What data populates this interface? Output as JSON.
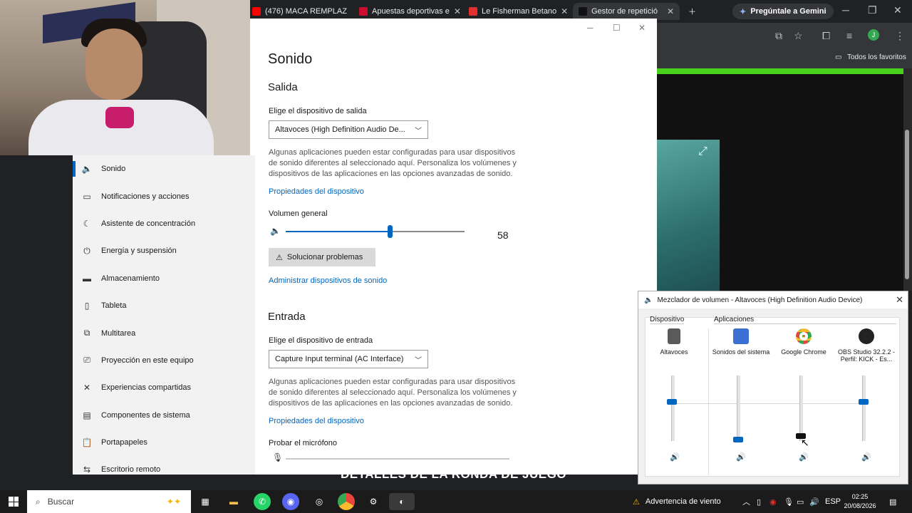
{
  "browser": {
    "tabs": [
      {
        "label": "(476) MACA REMPLAZ",
        "color": "#ff0000"
      },
      {
        "label": "Apuestas deportivas e",
        "color": "#c8102e"
      },
      {
        "label": "Le Fisherman Betano",
        "color": "#e03030"
      },
      {
        "label": "Gestor de repetició",
        "color": "#111111"
      }
    ],
    "gemini_label": "Pregúntale a Gemini",
    "bookmarks_label": "Todos los favoritos",
    "profile_initial": "J"
  },
  "settings": {
    "nav": [
      {
        "label": "Sonido",
        "icon": "speaker-icon",
        "glyph": "🔈"
      },
      {
        "label": "Notificaciones y acciones",
        "icon": "notification-icon",
        "glyph": "▭"
      },
      {
        "label": "Asistente de concentración",
        "icon": "moon-icon",
        "glyph": "☾"
      },
      {
        "label": "Energía y suspensión",
        "icon": "power-icon",
        "glyph": "⏻"
      },
      {
        "label": "Almacenamiento",
        "icon": "storage-icon",
        "glyph": "▬"
      },
      {
        "label": "Tableta",
        "icon": "tablet-icon",
        "glyph": "▯"
      },
      {
        "label": "Multitarea",
        "icon": "multitask-icon",
        "glyph": "⧉"
      },
      {
        "label": "Proyección en este equipo",
        "icon": "projection-icon",
        "glyph": "⎚"
      },
      {
        "label": "Experiencias compartidas",
        "icon": "shared-icon",
        "glyph": "✕"
      },
      {
        "label": "Componentes de sistema",
        "icon": "components-icon",
        "glyph": "▤"
      },
      {
        "label": "Portapapeles",
        "icon": "clipboard-icon",
        "glyph": "📋"
      },
      {
        "label": "Escritorio remoto",
        "icon": "remote-icon",
        "glyph": "⇆"
      }
    ],
    "page_title": "Sonido",
    "output": {
      "heading": "Salida",
      "device_label": "Elige el dispositivo de salida",
      "device_value": "Altavoces (High Definition Audio De...",
      "description": "Algunas aplicaciones pueden estar configuradas para usar dispositivos de sonido diferentes al seleccionado aquí. Personaliza los volúmenes y dispositivos de las aplicaciones en las opciones avanzadas de sonido.",
      "properties_link": "Propiedades del dispositivo",
      "volume_label": "Volumen general",
      "volume_value": 58,
      "troubleshoot_label": "Solucionar problemas",
      "manage_link": "Administrar dispositivos de sonido"
    },
    "input": {
      "heading": "Entrada",
      "device_label": "Elige el dispositivo de entrada",
      "device_value": "Capture Input terminal (AC Interface)",
      "description": "Algunas aplicaciones pueden estar configuradas para usar dispositivos de sonido diferentes al seleccionado aquí. Personaliza los volúmenes y dispositivos de las aplicaciones en las opciones avanzadas de sonido.",
      "properties_link": "Propiedades del dispositivo",
      "mic_test_label": "Probar el micrófono"
    }
  },
  "mixer": {
    "title": "Mezclador de volumen - Altavoces (High Definition Audio Device)",
    "device_section": "Dispositivo",
    "apps_section": "Aplicaciones",
    "channels": [
      {
        "name": "Altavoces",
        "level": 0.58,
        "icon": "speakers-icon",
        "color": "#5a5a5a"
      },
      {
        "name": "Sonidos del sistema",
        "level": 0.0,
        "icon": "system-sounds-icon",
        "color": "#3b6fd1"
      },
      {
        "name": "Google Chrome",
        "level": 0.05,
        "icon": "chrome-icon",
        "color": "#e8453c"
      },
      {
        "name": "OBS Studio 32.2.2 - Perfil: KICK - Es...",
        "level": 0.58,
        "icon": "obs-icon",
        "color": "#222222"
      }
    ]
  },
  "overlay_text": "DETALLES DE LA RONDA DE JUEGO",
  "taskbar": {
    "search_placeholder": "Buscar",
    "weather": "Advertencia de viento",
    "language": "ESP",
    "time": "02:25",
    "date": "20/08/2026"
  }
}
